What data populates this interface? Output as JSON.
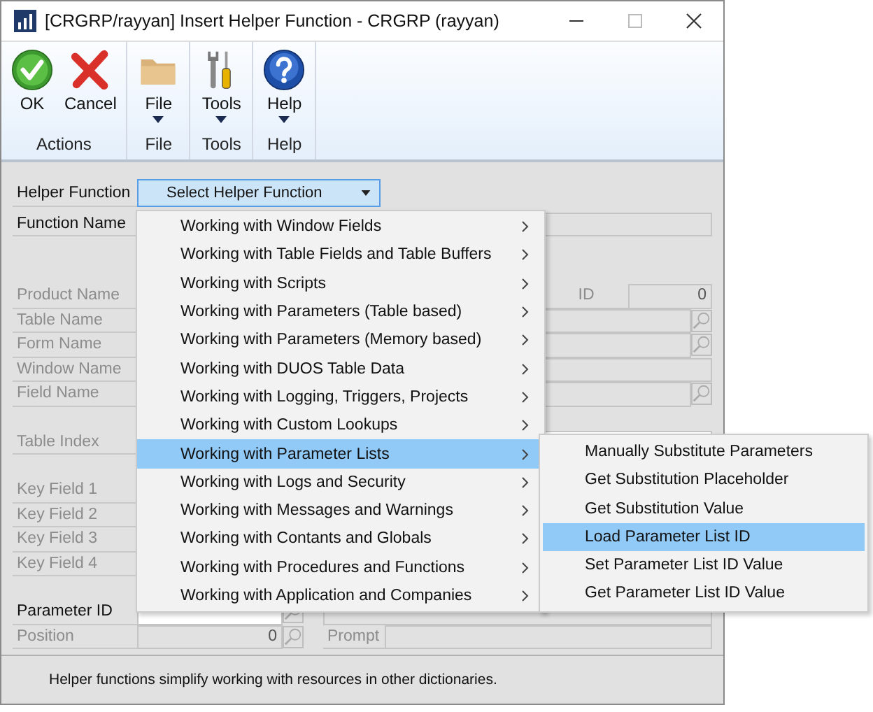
{
  "window": {
    "title": "[CRGRP/rayyan] Insert Helper Function  -  CRGRP (rayyan)"
  },
  "ribbon": {
    "groups": [
      {
        "label": "Actions",
        "buttons": [
          {
            "label": "OK",
            "kind": "ok",
            "dropdown": false
          },
          {
            "label": "Cancel",
            "kind": "cancel",
            "dropdown": false
          }
        ]
      },
      {
        "label": "File",
        "buttons": [
          {
            "label": "File",
            "kind": "folder",
            "dropdown": true
          }
        ]
      },
      {
        "label": "Tools",
        "buttons": [
          {
            "label": "Tools",
            "kind": "tools",
            "dropdown": true
          }
        ]
      },
      {
        "label": "Help",
        "buttons": [
          {
            "label": "Help",
            "kind": "help",
            "dropdown": true
          }
        ]
      }
    ]
  },
  "helper_function": {
    "label": "Helper Function",
    "button": "Select Helper Function"
  },
  "sections": [
    [
      {
        "label": "Function Name",
        "disabled": false,
        "kind": "text"
      }
    ],
    [
      {
        "label": "Product Name",
        "disabled": true,
        "kind": "id",
        "id_label": "ID",
        "value": "0"
      },
      {
        "label": "Table Name",
        "disabled": true,
        "kind": "lookup"
      },
      {
        "label": "Form Name",
        "disabled": true,
        "kind": "lookup"
      },
      {
        "label": "Window Name",
        "disabled": true,
        "kind": "text"
      },
      {
        "label": "Field Name",
        "disabled": true,
        "kind": "lookup"
      }
    ],
    [
      {
        "label": "Table Index",
        "disabled": true,
        "kind": "white"
      }
    ],
    [
      {
        "label": "Key Field 1",
        "disabled": true
      },
      {
        "label": "Key Field 2",
        "disabled": true
      },
      {
        "label": "Key Field 3",
        "disabled": true
      },
      {
        "label": "Key Field 4",
        "disabled": true
      }
    ]
  ],
  "parameter": {
    "label": "Parameter ID",
    "disabled": false
  },
  "position": {
    "label": "Position",
    "disabled": true,
    "value": "0",
    "prompt_label": "Prompt"
  },
  "menu": {
    "items": [
      {
        "label": "Working with Window Fields",
        "selected": false,
        "submenu": true
      },
      {
        "label": "Working with Table Fields and Table Buffers",
        "selected": false,
        "submenu": true
      },
      {
        "label": "Working with Scripts",
        "selected": false,
        "submenu": true
      },
      {
        "label": "Working with Parameters (Table based)",
        "selected": false,
        "submenu": true
      },
      {
        "label": "Working with Parameters (Memory based)",
        "selected": false,
        "submenu": true
      },
      {
        "label": "Working with DUOS Table Data",
        "selected": false,
        "submenu": true
      },
      {
        "label": "Working with Logging, Triggers, Projects",
        "selected": false,
        "submenu": true
      },
      {
        "label": "Working with Custom Lookups",
        "selected": false,
        "submenu": true
      },
      {
        "label": "Working with Parameter Lists",
        "selected": true,
        "submenu": true
      },
      {
        "label": "Working with Logs and Security",
        "selected": false,
        "submenu": true
      },
      {
        "label": "Working with Messages and Warnings",
        "selected": false,
        "submenu": true
      },
      {
        "label": "Working with Contants and Globals",
        "selected": false,
        "submenu": true
      },
      {
        "label": "Working with Procedures and Functions",
        "selected": false,
        "submenu": true
      },
      {
        "label": "Working with Application and Companies",
        "selected": false,
        "submenu": true
      }
    ]
  },
  "submenu": {
    "items": [
      {
        "label": "Manually Substitute Parameters",
        "selected": false
      },
      {
        "label": "Get Substitution Placeholder",
        "selected": false
      },
      {
        "label": "Get Substitution Value",
        "selected": false
      },
      {
        "label": "Load Parameter List ID",
        "selected": true
      },
      {
        "label": "Set Parameter List ID Value",
        "selected": false
      },
      {
        "label": "Get Parameter List ID Value",
        "selected": false
      }
    ]
  },
  "status_bar": {
    "text": "Helper functions simplify working with resources in other dictionaries."
  }
}
